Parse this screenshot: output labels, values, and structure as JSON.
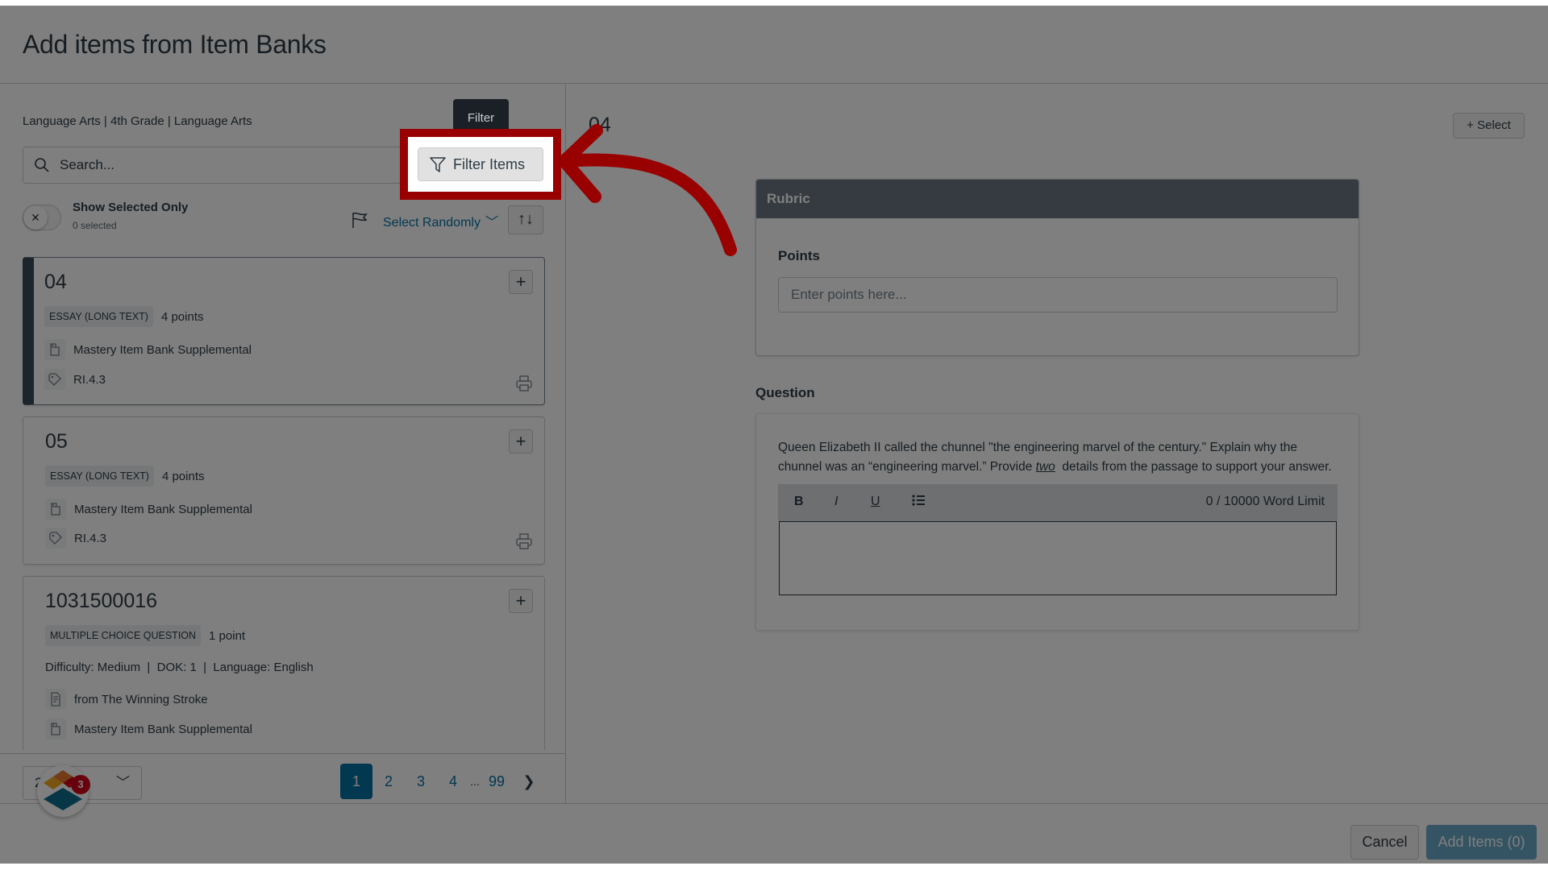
{
  "header": {
    "title": "Add items from Item Banks"
  },
  "left": {
    "breadcrumb": "Language Arts | 4th Grade | Language Arts",
    "search_placeholder": "Search...",
    "filter_button": "Filter Items",
    "filter_tooltip": "Filter",
    "show_selected": {
      "label": "Show Selected Only",
      "count": "0 selected",
      "on": false
    },
    "select_randomly": "Select Randomly",
    "items": [
      {
        "title": "04",
        "type": "ESSAY (LONG TEXT)",
        "points": "4 points",
        "bank": "Mastery Item Bank Supplemental",
        "standard": "RI.4.3",
        "active": true
      },
      {
        "title": "05",
        "type": "ESSAY (LONG TEXT)",
        "points": "4 points",
        "bank": "Mastery Item Bank Supplemental",
        "standard": "RI.4.3",
        "active": false
      },
      {
        "title": "1031500016",
        "type": "MULTIPLE CHOICE QUESTION",
        "points": "1 point",
        "meta": "Difficulty: Medium  |  DOK: 1  |  Language: English",
        "passage": "from The Winning Stroke",
        "bank": "Mastery Item Bank Supplemental",
        "active": false
      }
    ],
    "per_page": "25 Items",
    "pagination": {
      "pages": [
        "1",
        "2",
        "3",
        "4"
      ],
      "ellipsis": "...",
      "last": "99",
      "current": "1"
    },
    "notification_badge": "3"
  },
  "right": {
    "title": "04",
    "select_button": "Select",
    "rubric": {
      "header": "Rubric",
      "points_label": "Points",
      "points_placeholder": "Enter points here..."
    },
    "question": {
      "label": "Question",
      "text_before": "Queen Elizabeth II called the chunnel \"the engineering marvel of the century.\" Explain why the chunnel was an “engineering marvel.” Provide ",
      "text_emph": "two",
      "text_after": "  details from the passage to support your answer.",
      "toolbar": {
        "bold": "B",
        "italic": "I",
        "underline": "U"
      },
      "word_limit": "0 / 10000 Word Limit"
    }
  },
  "footer": {
    "cancel": "Cancel",
    "add_items": "Add Items (0)"
  },
  "annotation": {
    "highlight_color": "#990000"
  }
}
